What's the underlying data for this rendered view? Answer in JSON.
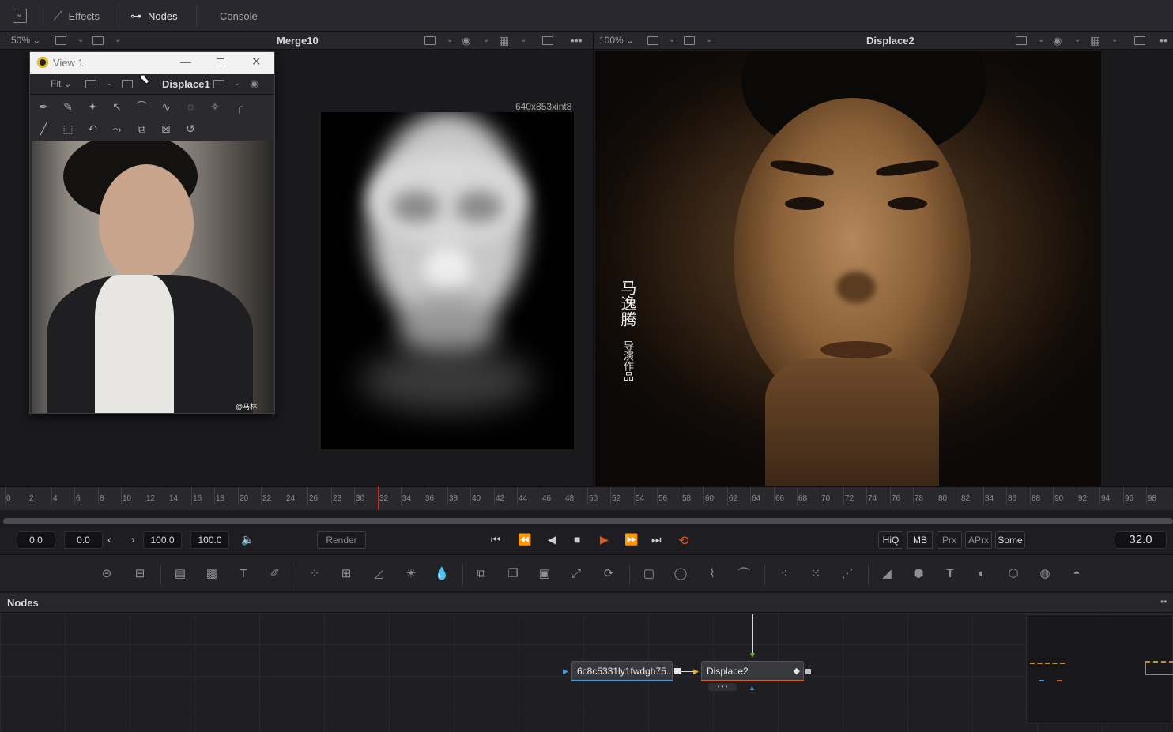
{
  "topbar": {
    "effects_label": "Effects",
    "nodes_label": "Nodes",
    "console_label": "Console"
  },
  "viewer_left": {
    "zoom": "50%",
    "title": "Merge10",
    "resolution": "640x853xint8"
  },
  "viewer_right": {
    "zoom": "100%",
    "title": "Displace2",
    "vertical_title": "马逸腾",
    "vertical_subtitle": "导演作品"
  },
  "float_window": {
    "title": "View 1",
    "fit_label": "Fit",
    "viewer_title": "Displace1",
    "watermark": "@马林"
  },
  "ruler": {
    "ticks": [
      "0",
      "2",
      "4",
      "6",
      "8",
      "10",
      "12",
      "14",
      "16",
      "18",
      "20",
      "22",
      "24",
      "26",
      "28",
      "30",
      "32",
      "34",
      "36",
      "38",
      "40",
      "42",
      "44",
      "46",
      "48",
      "50",
      "52",
      "54",
      "56",
      "58",
      "60",
      "62",
      "64",
      "66",
      "68",
      "70",
      "72",
      "74",
      "76",
      "78",
      "80",
      "82",
      "84",
      "86",
      "88",
      "90",
      "92",
      "94",
      "96",
      "98"
    ],
    "current_frame": 32
  },
  "transport": {
    "global_start": "0.0",
    "render_start": "0.0",
    "render_end": "100.0",
    "global_end": "100.0",
    "render_label": "Render",
    "hiq_label": "HiQ",
    "mb_label": "MB",
    "prx_label": "Prx",
    "aprx_label": "APrx",
    "some_label": "Some",
    "current_time": "32.0"
  },
  "nodes_panel": {
    "title": "Nodes",
    "node1_label": "6c8c5331ly1fwdgh75...",
    "node2_label": "Displace2"
  },
  "colors": {
    "accent_orange": "#e05a1a",
    "playhead_red": "#c0302a",
    "background": "#1c1c20"
  }
}
